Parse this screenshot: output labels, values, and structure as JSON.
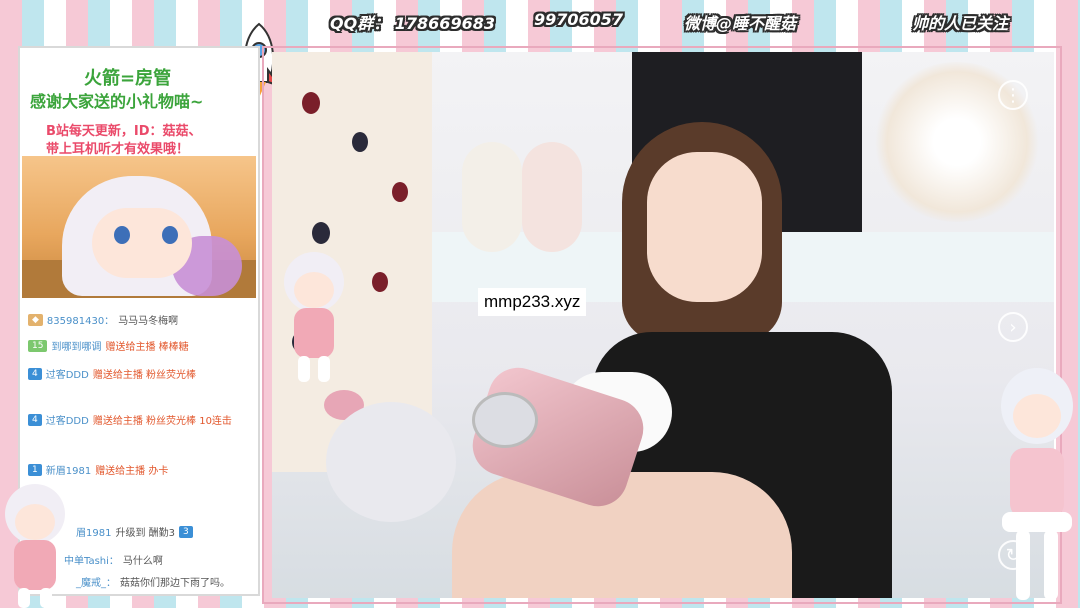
{
  "topbar": {
    "qq": "QQ群： 178669683",
    "qq2": "99706057",
    "weibo": "微博@睡不醒菇",
    "follow": "帅的人已关注"
  },
  "promo": {
    "line1": "火箭=房管",
    "line2": "感谢大家送的小礼物喵~",
    "line3": "B站每天更新，ID：菇菇、",
    "line4": "带上耳机听才有效果哦！"
  },
  "chat": [
    {
      "level": "",
      "user": "835981430：",
      "text": "马马马冬梅啊"
    },
    {
      "level": "15",
      "user": "到哪到哪调",
      "text": "赠送给主播 棒棒糖"
    },
    {
      "level": "4",
      "user": "过客DDD",
      "text": "赠送给主播 粉丝荧光棒"
    },
    {
      "level": "4",
      "user": "过客DDD",
      "text": "赠送给主播 粉丝荧光棒 10连击"
    },
    {
      "level": "1",
      "user": "新眉1981",
      "text": "赠送给主播 办卡"
    },
    {
      "level": "3",
      "user": "眉1981",
      "text": "升级到 酬勤3"
    },
    {
      "level": "",
      "user": "中单Tashi：",
      "text": "马什么啊"
    },
    {
      "level": "",
      "user": "_魔戒_：",
      "text": "菇菇你们那边下雨了吗。"
    }
  ],
  "stream": {
    "watermark": "mmp233.xyz"
  },
  "colors": {
    "accent_green": "#3ba43b",
    "accent_pink": "#ea4a6a"
  }
}
